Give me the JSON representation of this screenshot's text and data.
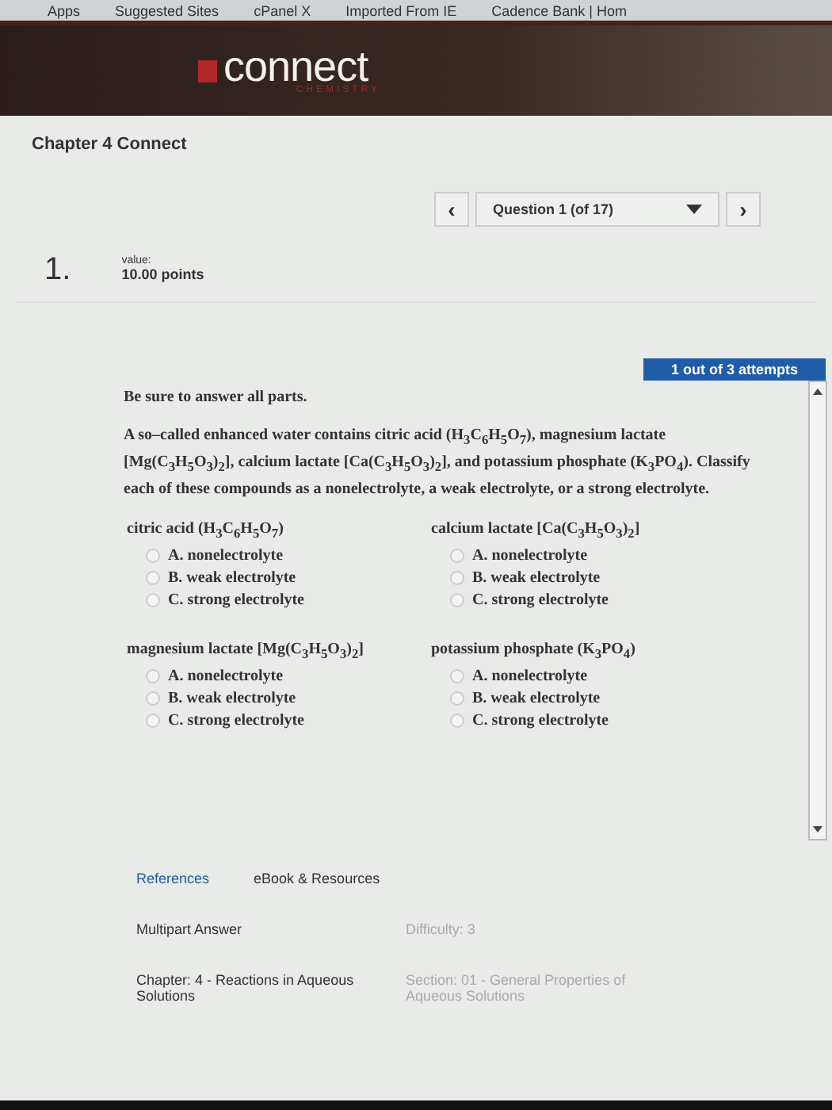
{
  "bookmarks": [
    "Apps",
    "Suggested Sites",
    "cPanel X",
    "Imported From IE",
    "Cadence Bank | Hom"
  ],
  "header": {
    "logo": "connect",
    "subject": "CHEMISTRY"
  },
  "assignment_title": "Chapter 4 Connect",
  "question_nav": {
    "label": "Question 1 (of 17)",
    "prev": "‹",
    "next": "›"
  },
  "question": {
    "number": "1.",
    "value_label": "value:",
    "points": "10.00 points",
    "attempts": "1 out of 3 attempts",
    "instruction": "Be sure to answer all parts.",
    "text": "A so–called enhanced water contains citric acid (H$_{3}$C$_{6}$H$_{5}$O$_{7}$), magnesium lactate [Mg(C$_{3}$H$_{5}$O$_{3}$)$_{2}$], calcium lactate [Ca(C$_{3}$H$_{5}$O$_{3}$)$_{2}$], and potassium phosphate (K$_{3}$PO$_{4}$). Classify each of these compounds as a nonelectrolyte, a weak electrolyte, or a strong electrolyte.",
    "parts": [
      {
        "compound": "citric acid (H$_{3}$C$_{6}$H$_{5}$O$_{7}$)",
        "options": [
          {
            "label": "A. nonelectrolyte",
            "selected": false
          },
          {
            "label": "B. weak electrolyte",
            "selected": false
          },
          {
            "label": "C. strong electrolyte",
            "selected": false
          }
        ]
      },
      {
        "compound": "calcium lactate [Ca(C$_{3}$H$_{5}$O$_{3}$)$_{2}$]",
        "options": [
          {
            "label": "A. nonelectrolyte",
            "selected": false
          },
          {
            "label": "B. weak electrolyte",
            "selected": false
          },
          {
            "label": "C. strong electrolyte",
            "selected": false
          }
        ]
      },
      {
        "compound": "magnesium lactate [Mg(C$_{3}$H$_{5}$O$_{3}$)$_{2}$]",
        "options": [
          {
            "label": "A. nonelectrolyte",
            "selected": false
          },
          {
            "label": "B. weak electrolyte",
            "selected": false
          },
          {
            "label": "C. strong electrolyte",
            "selected": false
          }
        ]
      },
      {
        "compound": "potassium phosphate (K$_{3}$PO$_{4}$)",
        "options": [
          {
            "label": "A. nonelectrolyte",
            "selected": false
          },
          {
            "label": "B. weak electrolyte",
            "selected": false
          },
          {
            "label": "C. strong electrolyte",
            "selected": false
          }
        ]
      }
    ]
  },
  "links": [
    "References",
    "eBook & Resources"
  ],
  "meta": [
    {
      "left": "Multipart Answer",
      "right": "Difficulty: 3"
    },
    {
      "left": "Chapter: 4 - Reactions in Aqueous Solutions",
      "right": "Section: 01 - General Properties of Aqueous Solutions"
    }
  ]
}
